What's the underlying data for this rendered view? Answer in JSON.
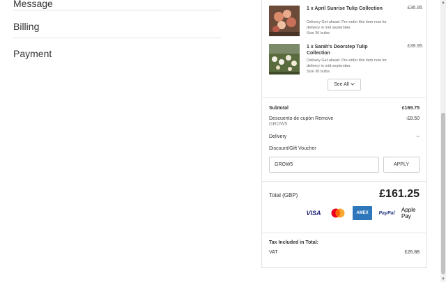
{
  "left_steps": [
    {
      "title": "Message"
    },
    {
      "title": "Billing"
    },
    {
      "title": "Payment"
    }
  ],
  "items": [
    {
      "name": "1 x April Sunrise Tulip Collection",
      "description": "Delivery Get ahead. Pre-order this item now for delivery in mid september.",
      "size": "Size 30 bulbs",
      "price": "£36.95"
    },
    {
      "name": "1 x Sarah's Doorstep Tulip Collection",
      "description": "Delivery Get ahead. Pre-order this item now for delivery in mid september.",
      "size": "Size 30 bulbs",
      "price": "£39.95"
    }
  ],
  "see_all_label": "See All",
  "summary": {
    "subtotal_label": "Subtotal",
    "subtotal_value": "£169.75",
    "discount_label": "Descuento de cupón Remove",
    "discount_code": "GROW5",
    "discount_value": "-£8.50",
    "delivery_label": "Delivery",
    "delivery_value": "--",
    "voucher_label": "Discount/Gift Voucher",
    "voucher_input_value": "GROW5",
    "apply_label": "APPLY",
    "total_label": "Total (GBP)",
    "total_value": "£161.25"
  },
  "payment_methods": [
    "VISA",
    "Mastercard",
    "AMEX",
    "PayPal",
    "Apple Pay"
  ],
  "tax": {
    "heading": "Tax Included in Total:",
    "vat_label": "VAT",
    "vat_value": "£26.88"
  },
  "colors": {
    "amex_blue": "#2e77bb",
    "visa_blue": "#1a1f71",
    "paypal_blue": "#253b80",
    "mastercard_red": "#eb001b",
    "mastercard_orange": "#f79e1b"
  }
}
